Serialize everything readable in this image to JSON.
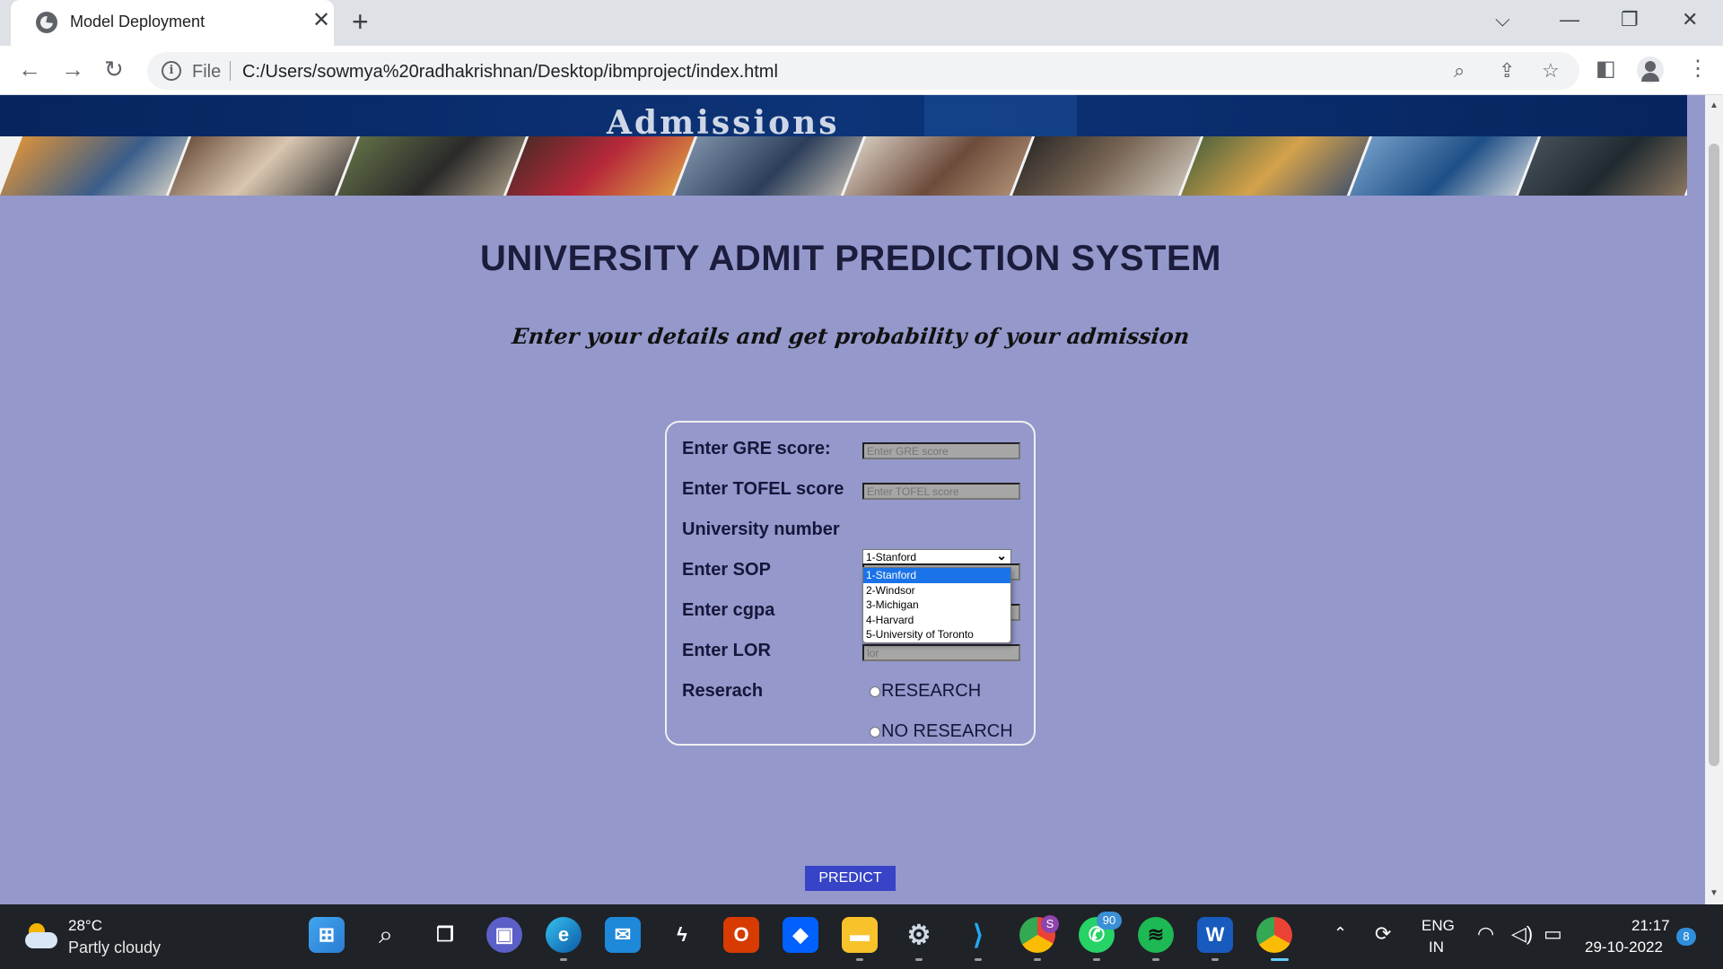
{
  "browser": {
    "tab_title": "Model Deployment",
    "tab_close": "✕",
    "new_tab": "+",
    "scheme": "File",
    "url": "C:/Users/sowmya%20radhakrishnan/Desktop/ibmproject/index.html"
  },
  "page": {
    "banner_title": "Admissions",
    "heading": "UNIVERSITY ADMIT PREDICTION SYSTEM",
    "subheading": "Enter your details and get probability of your admission",
    "form": {
      "gre_label": "Enter GRE score:",
      "gre_placeholder": "Enter GRE score",
      "tofel_label": "Enter TOFEL score",
      "tofel_placeholder": "Enter TOFEL score",
      "university_label": "University number",
      "university_selected": "1-Stanford",
      "university_options": [
        "1-Stanford",
        "2-Windsor",
        "3-Michigan",
        "4-Harvard",
        "5-University of Toronto"
      ],
      "sop_label": "Enter SOP",
      "cgpa_label": "Enter cgpa",
      "cgpa_placeholder": "cgpa",
      "lor_label": "Enter LOR",
      "lor_placeholder": "lor",
      "research_label": "Reserach",
      "research_yes": "RESEARCH",
      "research_no": "NO RESEARCH"
    },
    "predict_label": "PREDICT"
  },
  "taskbar": {
    "temperature": "28°C",
    "condition": "Partly cloudy",
    "whatsapp_badge": "90",
    "chrome_profile_badge": "S",
    "language": "ENG",
    "region": "IN",
    "time": "21:17",
    "date": "29-10-2022",
    "notification_count": "8"
  },
  "colors": {
    "page_background": "#9498cb",
    "predict_button": "#3744c7",
    "banner": "#07245e"
  }
}
